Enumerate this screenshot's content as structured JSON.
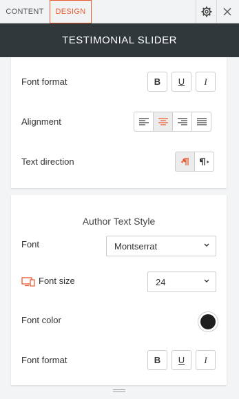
{
  "tabs": {
    "content": "CONTENT",
    "design": "DESIGN"
  },
  "header": {
    "title": "TESTIMONIAL SLIDER"
  },
  "panel1": {
    "font_format_label": "Font format",
    "alignment_label": "Alignment",
    "text_direction_label": "Text direction",
    "format_buttons": {
      "bold": "B",
      "underline": "U",
      "italic": "I"
    }
  },
  "panel2": {
    "section_title": "Author Text Style",
    "font_label": "Font",
    "font_value": "Montserrat",
    "font_size_label": "Font size",
    "font_size_value": "24",
    "font_color_label": "Font color",
    "font_color": "#1e1e1e",
    "font_format_label": "Font format",
    "format_buttons": {
      "bold": "B",
      "underline": "U",
      "italic": "I"
    }
  },
  "colors": {
    "accent": "#e8582d",
    "header_bg": "#30383b"
  }
}
